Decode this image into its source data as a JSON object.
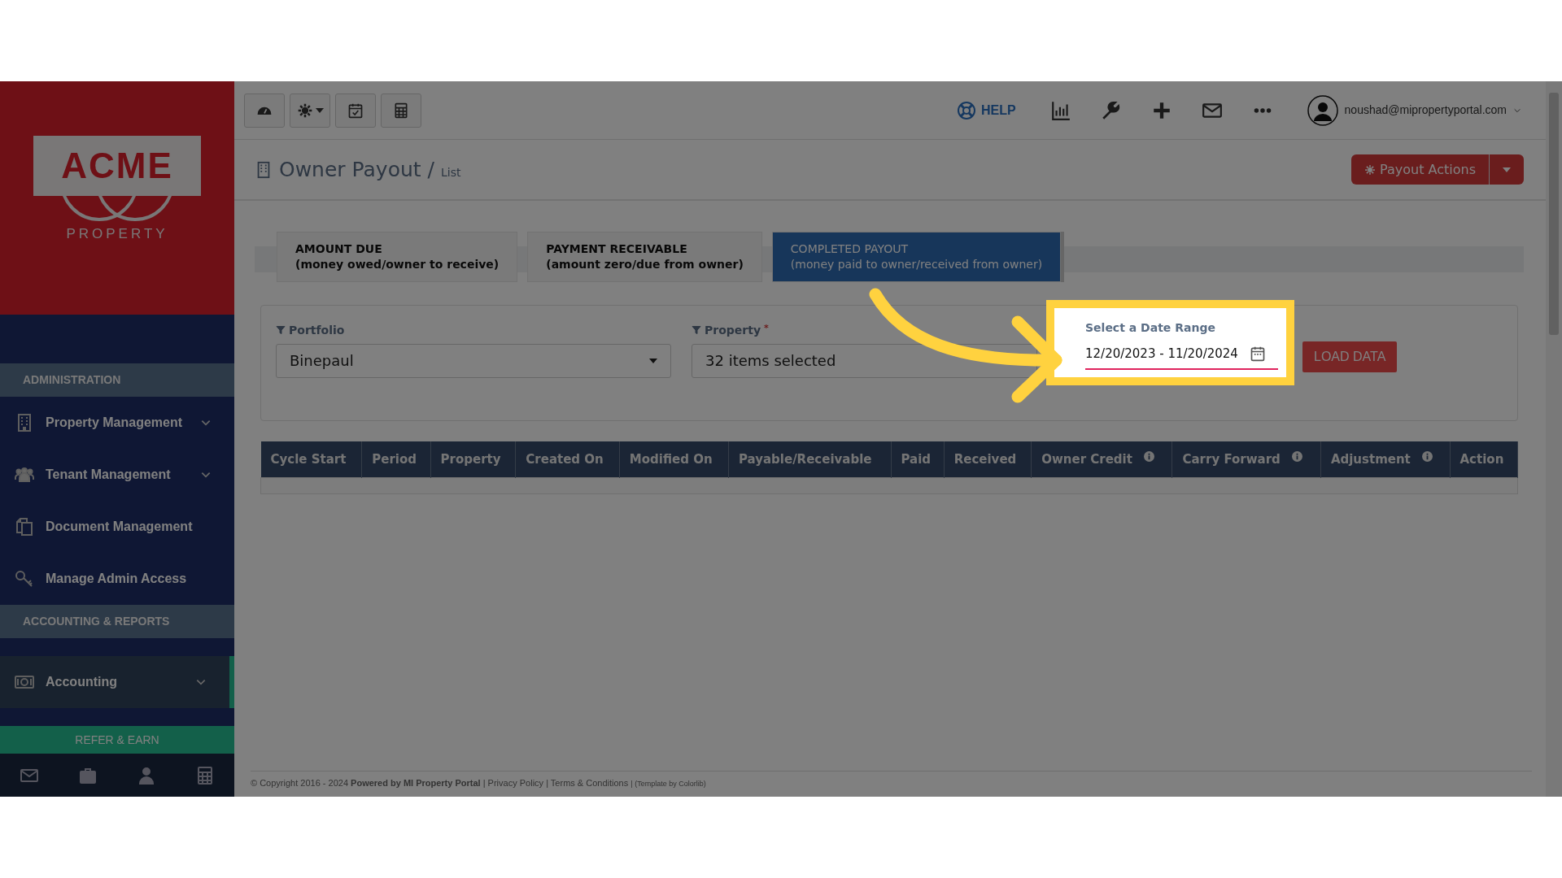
{
  "logo": {
    "wordmark": "ACME",
    "tagline": "PROPERTY"
  },
  "sidebar": {
    "sections": [
      {
        "title": "ADMINISTRATION",
        "items": [
          {
            "label": "Property Management",
            "expandable": true,
            "selected": false
          },
          {
            "label": "Tenant Management",
            "expandable": true,
            "selected": false
          },
          {
            "label": "Document Management",
            "expandable": false,
            "selected": false
          },
          {
            "label": "Manage Admin Access",
            "expandable": false,
            "selected": false
          }
        ]
      },
      {
        "title": "ACCOUNTING & REPORTS",
        "items": [
          {
            "label": "Accounting",
            "expandable": true,
            "selected": true
          }
        ]
      }
    ],
    "refer_button": "REFER & EARN"
  },
  "toolbar": {
    "buttons": [
      {
        "dropdown": false
      },
      {
        "dropdown": true
      },
      {
        "dropdown": false
      },
      {
        "dropdown": false
      }
    ]
  },
  "top_nav": {
    "help": "HELP",
    "user_email": "noushad@mipropertyportal.com"
  },
  "page": {
    "title": "Owner Payout",
    "separator": "/",
    "subtitle": "List",
    "actions_button": "Payout Actions"
  },
  "tabs": [
    {
      "title": "AMOUNT DUE",
      "subtitle": "(money owed/owner to receive)",
      "selected": false
    },
    {
      "title": "PAYMENT RECEIVABLE",
      "subtitle": "(amount zero/due from owner)",
      "selected": false
    },
    {
      "title": "COMPLETED PAYOUT",
      "subtitle": "(money paid to owner/received from owner)",
      "selected": true
    }
  ],
  "filters": {
    "portfolio": {
      "label": "Portfolio",
      "value": "Binepaul"
    },
    "property": {
      "label": "Property",
      "required_mark": "*",
      "value": "32 items selected"
    },
    "date_range": {
      "label": "Select a Date Range",
      "value": "12/20/2023 - 11/20/2024",
      "highlighted": true
    },
    "load_button": "LOAD DATA"
  },
  "table": {
    "columns": [
      {
        "label": "Cycle Start",
        "info": false
      },
      {
        "label": "Period",
        "info": false
      },
      {
        "label": "Property",
        "info": false
      },
      {
        "label": "Created On",
        "info": false
      },
      {
        "label": "Modified On",
        "info": false
      },
      {
        "label": "Payable/Receivable",
        "info": false
      },
      {
        "label": "Paid",
        "info": false
      },
      {
        "label": "Received",
        "info": false
      },
      {
        "label": "Owner Credit",
        "info": true
      },
      {
        "label": "Carry Forward",
        "info": true
      },
      {
        "label": "Adjustment",
        "info": true
      },
      {
        "label": "Action",
        "info": false
      }
    ]
  },
  "footer": {
    "parts": [
      {
        "kind": "text",
        "text": "© Copyright 2016 - 2024 **Powered by MI Property Portal**"
      },
      {
        "kind": "text",
        "text": "|"
      },
      {
        "kind": "link",
        "text": "Privacy Policy"
      },
      {
        "kind": "text",
        "text": "|"
      },
      {
        "kind": "link",
        "text": "Terms & Conditions"
      },
      {
        "kind": "small",
        "text": "| (Template by Colorlib)"
      }
    ]
  }
}
